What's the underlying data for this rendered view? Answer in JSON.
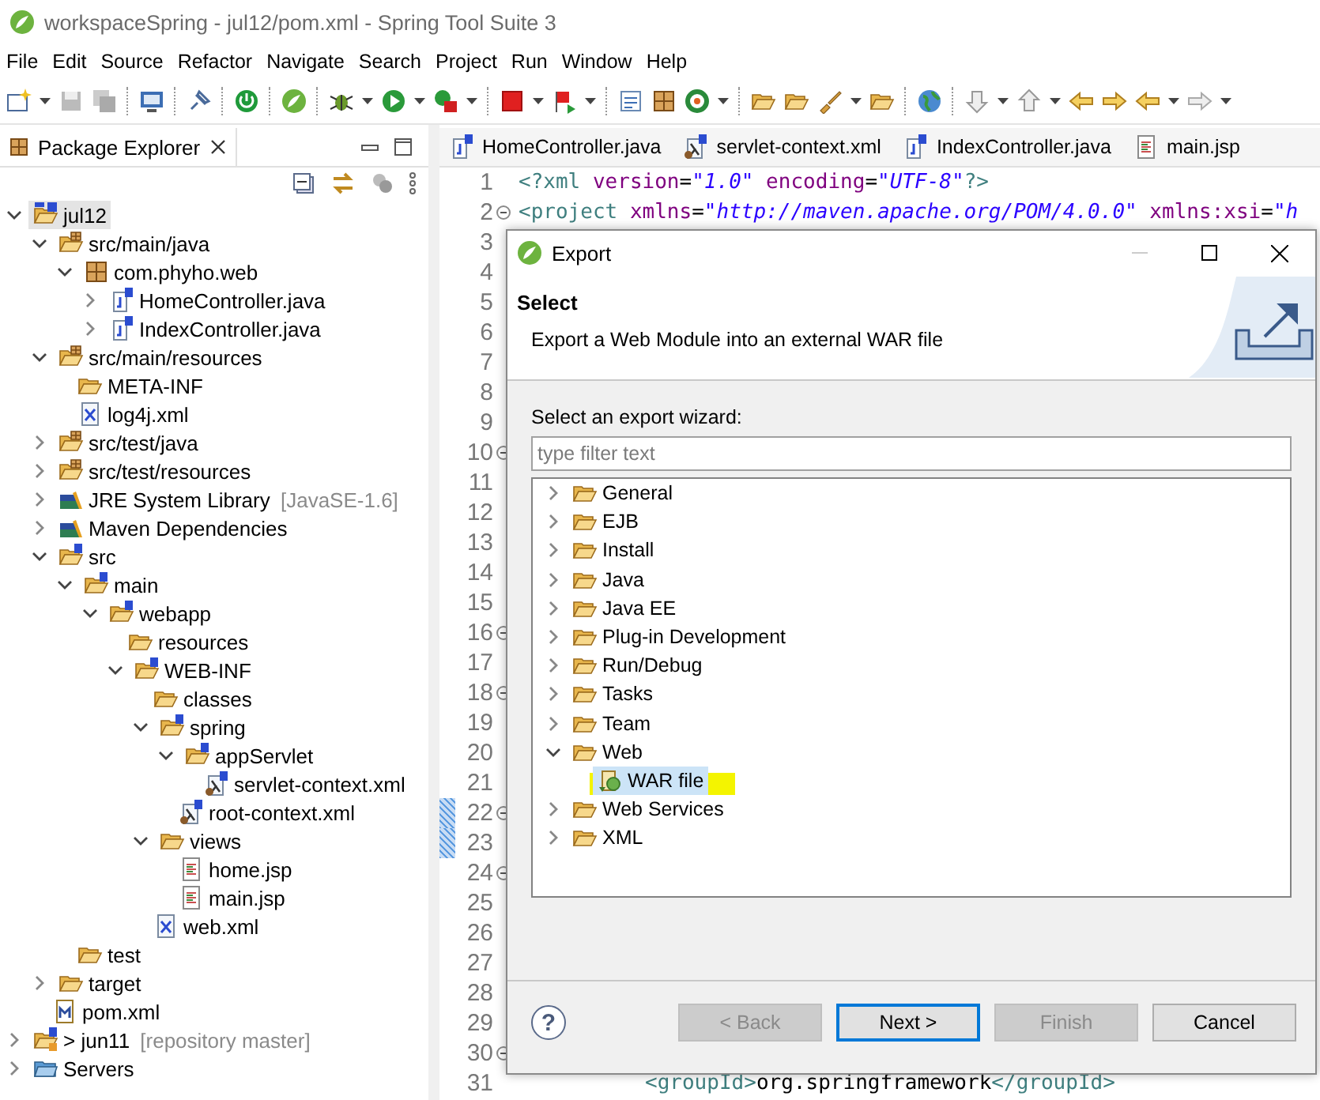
{
  "window": {
    "title": "workspaceSpring - jul12/pom.xml - Spring Tool Suite 3"
  },
  "menu": [
    "File",
    "Edit",
    "Source",
    "Refactor",
    "Navigate",
    "Search",
    "Project",
    "Run",
    "Window",
    "Help"
  ],
  "explorer": {
    "title": "Package Explorer",
    "tree": [
      {
        "label": "jul12",
        "kind": "project",
        "expanded": true,
        "selected": true,
        "children": [
          {
            "label": "src/main/java",
            "kind": "source-folder",
            "expanded": true,
            "selected": false,
            "children": [
              {
                "label": "com.phyho.web",
                "kind": "package",
                "expanded": true,
                "selected": false,
                "children": [
                  {
                    "label": "HomeController.java",
                    "kind": "java-file",
                    "expanded": false,
                    "selected": false
                  },
                  {
                    "label": "IndexController.java",
                    "kind": "java-file",
                    "expanded": false,
                    "selected": false
                  }
                ]
              }
            ]
          },
          {
            "label": "src/main/resources",
            "kind": "source-folder",
            "expanded": true,
            "selected": false,
            "children": [
              {
                "label": "META-INF",
                "kind": "folder",
                "selected": false
              },
              {
                "label": "log4j.xml",
                "kind": "xml-file",
                "selected": false
              }
            ]
          },
          {
            "label": "src/test/java",
            "kind": "source-folder",
            "expanded": false,
            "selected": false
          },
          {
            "label": "src/test/resources",
            "kind": "source-folder",
            "expanded": false,
            "selected": false
          },
          {
            "label": "JRE System Library",
            "decoration": "[JavaSE-1.6]",
            "kind": "library",
            "expanded": false,
            "selected": false
          },
          {
            "label": "Maven Dependencies",
            "kind": "library",
            "expanded": false,
            "selected": false
          },
          {
            "label": "src",
            "kind": "spring-folder",
            "expanded": true,
            "selected": false,
            "children": [
              {
                "label": "main",
                "kind": "spring-folder",
                "expanded": true,
                "selected": false,
                "children": [
                  {
                    "label": "webapp",
                    "kind": "spring-folder",
                    "expanded": true,
                    "selected": false,
                    "children": [
                      {
                        "label": "resources",
                        "kind": "folder",
                        "selected": false
                      },
                      {
                        "label": "WEB-INF",
                        "kind": "spring-folder",
                        "expanded": true,
                        "selected": false,
                        "children": [
                          {
                            "label": "classes",
                            "kind": "folder",
                            "selected": false
                          },
                          {
                            "label": "spring",
                            "kind": "spring-folder",
                            "expanded": true,
                            "selected": false,
                            "children": [
                              {
                                "label": "appServlet",
                                "kind": "spring-folder",
                                "expanded": true,
                                "selected": false,
                                "children": [
                                  {
                                    "label": "servlet-context.xml",
                                    "kind": "spring-xml",
                                    "selected": false
                                  }
                                ]
                              },
                              {
                                "label": "root-context.xml",
                                "kind": "spring-xml",
                                "selected": false
                              }
                            ]
                          },
                          {
                            "label": "views",
                            "kind": "folder",
                            "expanded": true,
                            "selected": false,
                            "children": [
                              {
                                "label": "home.jsp",
                                "kind": "jsp-file",
                                "selected": false
                              },
                              {
                                "label": "main.jsp",
                                "kind": "jsp-file",
                                "selected": false
                              }
                            ]
                          },
                          {
                            "label": "web.xml",
                            "kind": "xml-file",
                            "selected": false
                          }
                        ]
                      }
                    ]
                  }
                ]
              },
              {
                "label": "test",
                "kind": "folder",
                "selected": false
              }
            ]
          },
          {
            "label": "target",
            "kind": "folder",
            "expanded": false,
            "selected": false
          },
          {
            "label": "pom.xml",
            "kind": "maven-file",
            "selected": false
          }
        ]
      },
      {
        "label": "> jun11",
        "decoration": "[repository master]",
        "kind": "repo-project",
        "expanded": false,
        "selected": false
      },
      {
        "label": "Servers",
        "kind": "servers",
        "expanded": false,
        "selected": false
      }
    ]
  },
  "editor": {
    "tabs": [
      {
        "label": "HomeController.java",
        "kind": "java-file",
        "selected": false
      },
      {
        "label": "servlet-context.xml",
        "kind": "spring-xml",
        "selected": false
      },
      {
        "label": "IndexController.java",
        "kind": "java-file",
        "selected": false
      },
      {
        "label": "main.jsp",
        "kind": "jsp-file",
        "selected": false
      }
    ],
    "lines": [
      {
        "number": "1",
        "code": [
          {
            "kind": "tag",
            "text": "<?xml"
          },
          {
            "kind": "attr",
            "text": " version"
          },
          {
            "kind": "plain",
            "text": "="
          },
          {
            "kind": "value",
            "text": "\"1.0\""
          },
          {
            "kind": "attr",
            "text": " encoding"
          },
          {
            "kind": "plain",
            "text": "="
          },
          {
            "kind": "value",
            "text": "\"UTF-8\""
          },
          {
            "kind": "tag",
            "text": "?>"
          }
        ]
      },
      {
        "number": "2",
        "foldable": true,
        "code": [
          {
            "kind": "tag",
            "text": "<project"
          },
          {
            "kind": "attr",
            "text": " xmlns"
          },
          {
            "kind": "plain",
            "text": "="
          },
          {
            "kind": "value",
            "text": "\"http://maven.apache.org/POM/4.0.0\""
          },
          {
            "kind": "attr",
            "text": " xmlns:xsi"
          },
          {
            "kind": "plain",
            "text": "="
          },
          {
            "kind": "value",
            "text": "\"h"
          }
        ]
      },
      {
        "number": "3"
      },
      {
        "number": "4"
      },
      {
        "number": "5"
      },
      {
        "number": "6"
      },
      {
        "number": "7"
      },
      {
        "number": "8"
      },
      {
        "number": "9"
      },
      {
        "number": "10",
        "foldable": true
      },
      {
        "number": "11"
      },
      {
        "number": "12"
      },
      {
        "number": "13"
      },
      {
        "number": "14"
      },
      {
        "number": "15"
      },
      {
        "number": "16",
        "foldable": true
      },
      {
        "number": "17"
      },
      {
        "number": "18",
        "foldable": true
      },
      {
        "number": "19"
      },
      {
        "number": "20"
      },
      {
        "number": "21"
      },
      {
        "number": "22",
        "foldable": true,
        "marked": true
      },
      {
        "number": "23",
        "marked": true
      },
      {
        "number": "24",
        "foldable": true
      },
      {
        "number": "25"
      },
      {
        "number": "26"
      },
      {
        "number": "27"
      },
      {
        "number": "28"
      },
      {
        "number": "29"
      },
      {
        "number": "30",
        "foldable": true
      },
      {
        "number": "31",
        "code": [
          {
            "kind": "tag",
            "text": "<groupId>"
          },
          {
            "kind": "plain",
            "text": "org.springframework"
          },
          {
            "kind": "tag",
            "text": "</groupId>"
          }
        ]
      }
    ]
  },
  "dialog": {
    "title": "Export",
    "heading": "Select",
    "description": "Export a Web Module into an external WAR file",
    "prompt": "Select an export wizard:",
    "filter": {
      "placeholder": "type filter text"
    },
    "wizards": [
      {
        "label": "General",
        "kind": "folder",
        "expanded": false,
        "selected": false
      },
      {
        "label": "EJB",
        "kind": "folder",
        "expanded": false,
        "selected": false
      },
      {
        "label": "Install",
        "kind": "folder",
        "expanded": false,
        "selected": false
      },
      {
        "label": "Java",
        "kind": "folder",
        "expanded": false,
        "selected": false
      },
      {
        "label": "Java EE",
        "kind": "folder",
        "expanded": false,
        "selected": false
      },
      {
        "label": "Plug-in Development",
        "kind": "folder",
        "expanded": false,
        "selected": false
      },
      {
        "label": "Run/Debug",
        "kind": "folder",
        "expanded": false,
        "selected": false
      },
      {
        "label": "Tasks",
        "kind": "folder",
        "expanded": false,
        "selected": false
      },
      {
        "label": "Team",
        "kind": "folder",
        "expanded": false,
        "selected": false
      },
      {
        "label": "Web",
        "kind": "folder",
        "expanded": true,
        "selected": false,
        "children": [
          {
            "label": "WAR file",
            "kind": "war-file",
            "selected": true,
            "marked": true
          }
        ]
      },
      {
        "label": "Web Services",
        "kind": "folder",
        "expanded": false,
        "selected": false
      },
      {
        "label": "XML",
        "kind": "folder",
        "expanded": false,
        "selected": false
      }
    ],
    "help": "?",
    "buttons": [
      {
        "label": "< Back",
        "disabled": true,
        "default": false
      },
      {
        "label": "Next >",
        "disabled": false,
        "default": true
      },
      {
        "label": "Finish",
        "disabled": true,
        "default": false
      },
      {
        "label": "Cancel",
        "disabled": false,
        "default": false
      }
    ]
  }
}
